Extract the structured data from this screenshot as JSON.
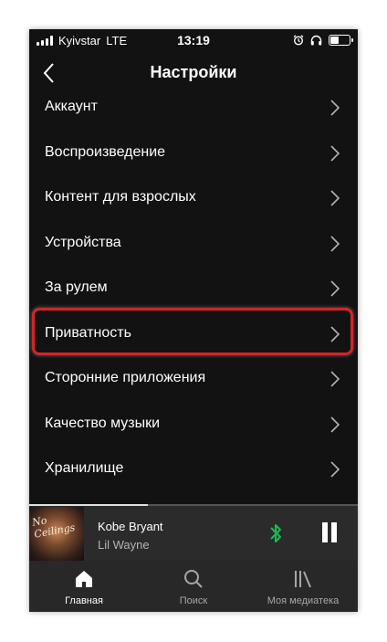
{
  "status_bar": {
    "carrier": "Kyivstar",
    "network": "LTE",
    "time": "13:19",
    "icons": [
      "alarm-icon",
      "headphones-icon",
      "battery-icon"
    ],
    "battery_level": 0.5
  },
  "header": {
    "title": "Настройки",
    "back_icon": "chevron-left-icon"
  },
  "settings": {
    "items": [
      {
        "label": "Аккаунт"
      },
      {
        "label": "Воспроизведение"
      },
      {
        "label": "Контент для взрослых"
      },
      {
        "label": "Устройства"
      },
      {
        "label": "За рулем"
      },
      {
        "label": "Приватность",
        "highlighted": true
      },
      {
        "label": "Сторонние приложения"
      },
      {
        "label": "Качество музыки"
      },
      {
        "label": "Хранилище"
      }
    ],
    "highlight_color": "#d0262a"
  },
  "now_playing": {
    "title": "Kobe Bryant",
    "artist": "Lil Wayne",
    "progress": 0.36,
    "cover_text": "No Ceilings",
    "bluetooth_color": "#1db954",
    "icons": [
      "bluetooth-icon",
      "pause-icon"
    ]
  },
  "tabbar": {
    "tabs": [
      {
        "label": "Главная",
        "icon": "home-icon",
        "active": true
      },
      {
        "label": "Поиск",
        "icon": "search-icon",
        "active": false
      },
      {
        "label": "Моя медиатека",
        "icon": "library-icon",
        "active": false
      }
    ],
    "active_color": "#ffffff",
    "inactive_color": "#a7a7a7"
  },
  "colors": {
    "background": "#121212",
    "player_bar": "#2b2b2b",
    "tab_bar": "#282828",
    "text": "#ffffff",
    "secondary_text": "#b3b3b3"
  }
}
